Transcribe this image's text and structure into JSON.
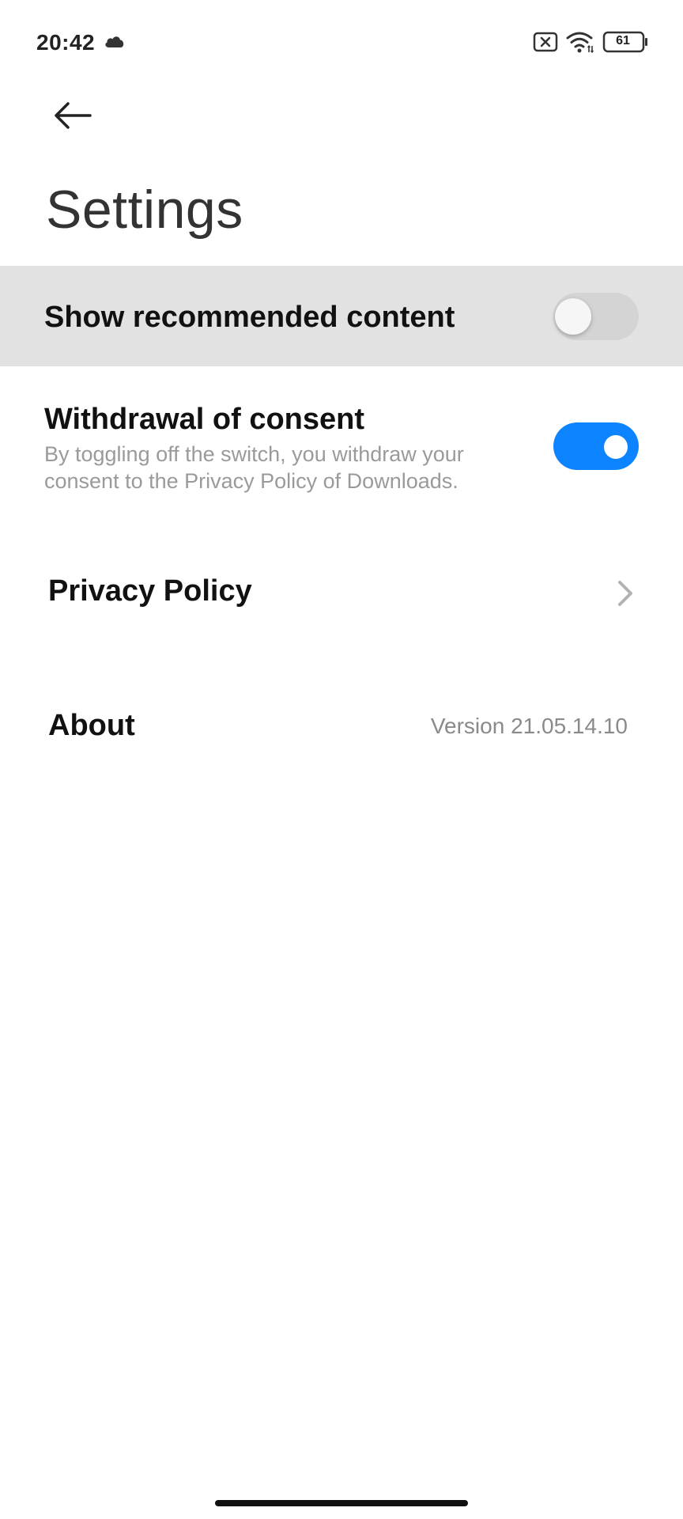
{
  "status_bar": {
    "time": "20:42",
    "battery": "61",
    "icons": [
      "cloud-icon",
      "no-sim-icon",
      "wifi-icon",
      "battery-icon"
    ]
  },
  "header": {
    "back_icon": "back-arrow-icon",
    "title": "Settings"
  },
  "settings": {
    "recommended": {
      "label": "Show recommended content",
      "enabled": false
    },
    "consent": {
      "label": "Withdrawal of consent",
      "description": "By toggling off the switch, you withdraw your consent to the Privacy Policy of Downloads.",
      "enabled": true
    },
    "privacy": {
      "label": "Privacy Policy",
      "icon": "chevron-right-icon"
    },
    "about": {
      "label": "About",
      "version": "Version 21.05.14.10"
    }
  },
  "colors": {
    "accent": "#0d84ff",
    "highlight_row": "#e2e2e2",
    "secondary_text": "#9a9a9a"
  }
}
